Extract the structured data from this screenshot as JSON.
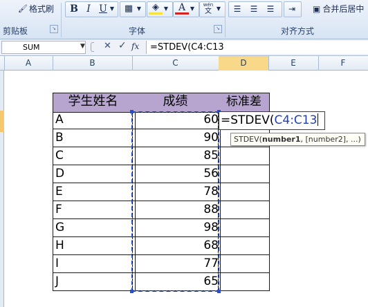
{
  "ribbon": {
    "format_painter_label": "格式刷",
    "bold": "B",
    "italic": "I",
    "underline": "U",
    "font_color_letter": "A",
    "phonetic_label": "wén",
    "phonetic_char": "文",
    "merge_center_label": "合并后居中",
    "groups": {
      "clipboard": "剪贴板",
      "font": "字体",
      "alignment": "对齐方式"
    }
  },
  "formula_bar": {
    "name_box": "SUM",
    "cancel_symbol": "✕",
    "enter_symbol": "✓",
    "fx_label": "fx",
    "formula": "=STDEV(C4:C13"
  },
  "columns": [
    "A",
    "B",
    "C",
    "D",
    "E",
    "F"
  ],
  "table": {
    "headers": [
      "学生姓名",
      "成绩",
      "标准差"
    ],
    "rows": [
      {
        "name": "A",
        "score": "60"
      },
      {
        "name": "B",
        "score": "90"
      },
      {
        "name": "C",
        "score": "85"
      },
      {
        "name": "D",
        "score": "56"
      },
      {
        "name": "E",
        "score": "78"
      },
      {
        "name": "F",
        "score": "88"
      },
      {
        "name": "G",
        "score": "98"
      },
      {
        "name": "H",
        "score": "68"
      },
      {
        "name": "I",
        "score": "77"
      },
      {
        "name": "J",
        "score": "65"
      }
    ],
    "active_cell_text_prefix": "=STDEV(",
    "active_cell_text_ref": "C4:C13"
  },
  "tooltip": {
    "func": "STDEV(",
    "arg1": "number1",
    "rest": ", [number2], ...)"
  },
  "colors": {
    "header_fill": "#b7a5cf",
    "selected_column_header": "#f8d98a",
    "reference_blue": "#1f3fbf"
  }
}
